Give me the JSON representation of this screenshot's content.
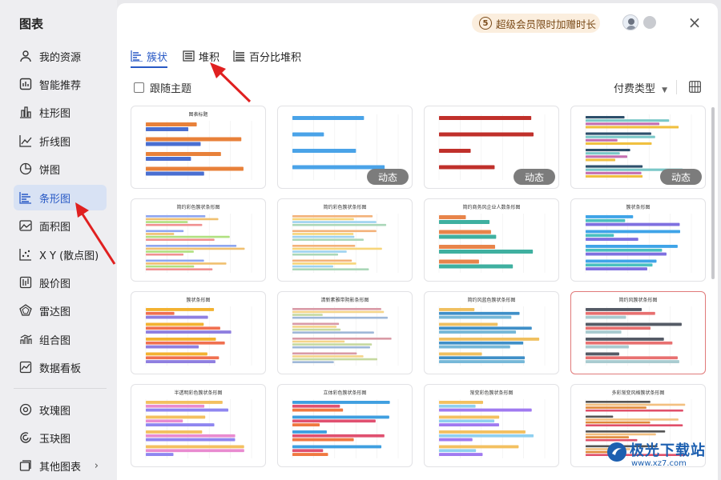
{
  "sidebar": {
    "title": "图表",
    "items": [
      {
        "label": "我的资源",
        "icon": "person-icon"
      },
      {
        "label": "智能推荐",
        "icon": "recommend-icon"
      },
      {
        "label": "柱形图",
        "icon": "column-chart-icon"
      },
      {
        "label": "折线图",
        "icon": "line-chart-icon"
      },
      {
        "label": "饼图",
        "icon": "pie-chart-icon"
      },
      {
        "label": "条形图",
        "icon": "bar-chart-icon",
        "active": true
      },
      {
        "label": "面积图",
        "icon": "area-chart-icon"
      },
      {
        "label": "X Y (散点图)",
        "icon": "scatter-chart-icon"
      },
      {
        "label": "股价图",
        "icon": "stock-chart-icon"
      },
      {
        "label": "雷达图",
        "icon": "radar-chart-icon"
      },
      {
        "label": "组合图",
        "icon": "combo-chart-icon"
      },
      {
        "label": "数据看板",
        "icon": "dashboard-icon"
      },
      {
        "label": "玫瑰图",
        "icon": "rose-chart-icon"
      },
      {
        "label": "玉玦图",
        "icon": "ring-chart-icon"
      },
      {
        "label": "其他图表",
        "icon": "other-chart-icon"
      }
    ]
  },
  "header": {
    "promo": "超级会员限时加赠时长",
    "promo_icon": "5"
  },
  "tabs": [
    "簇状",
    "堆积",
    "百分比堆积"
  ],
  "toolbar": {
    "follow_theme": "跟随主题",
    "pay_type": "付费类型"
  },
  "dynamic_label": "动态",
  "cards": [
    {
      "title": "图表标题",
      "dynamic": false
    },
    {
      "title": "",
      "dynamic": true
    },
    {
      "title": "",
      "dynamic": true
    },
    {
      "title": "",
      "dynamic": true
    },
    {
      "title": "简约彩色簇状条形图",
      "dynamic": false
    },
    {
      "title": "简约彩色簇状条形图",
      "dynamic": false
    },
    {
      "title": "简约商务风企业人数条形图",
      "dynamic": false
    },
    {
      "title": "簇状条形图",
      "dynamic": false
    },
    {
      "title": "簇状条形图",
      "dynamic": false
    },
    {
      "title": "清新素雅带阴影条形图",
      "dynamic": false
    },
    {
      "title": "简约风蓝色簇状条形图",
      "dynamic": false
    },
    {
      "title": "简约风簇状条形图",
      "dynamic": false,
      "selected": true
    },
    {
      "title": "半透明彩色簇状条形图",
      "dynamic": false
    },
    {
      "title": "立体彩色簇状条形图",
      "dynamic": false
    },
    {
      "title": "渐变彩色簇状条形图",
      "dynamic": false
    },
    {
      "title": "多彩渐变风格簇状条形图",
      "dynamic": false
    }
  ],
  "watermark": {
    "name": "极光下载站",
    "url": "www.xz7.com"
  },
  "colors": {
    "accent": "#2859c5",
    "active_bg": "#d8e2f4",
    "arrow": "#e02020"
  }
}
